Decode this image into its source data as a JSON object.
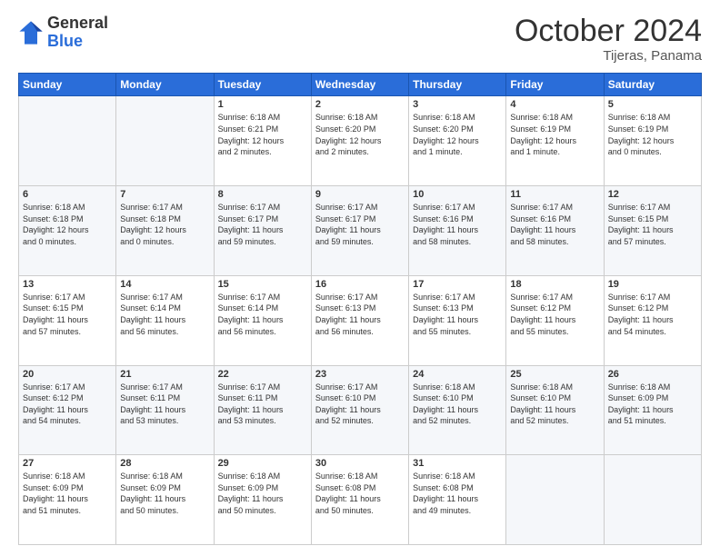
{
  "header": {
    "logo_general": "General",
    "logo_blue": "Blue",
    "month_title": "October 2024",
    "location": "Tijeras, Panama"
  },
  "days_of_week": [
    "Sunday",
    "Monday",
    "Tuesday",
    "Wednesday",
    "Thursday",
    "Friday",
    "Saturday"
  ],
  "weeks": [
    [
      {
        "num": "",
        "info": ""
      },
      {
        "num": "",
        "info": ""
      },
      {
        "num": "1",
        "info": "Sunrise: 6:18 AM\nSunset: 6:21 PM\nDaylight: 12 hours\nand 2 minutes."
      },
      {
        "num": "2",
        "info": "Sunrise: 6:18 AM\nSunset: 6:20 PM\nDaylight: 12 hours\nand 2 minutes."
      },
      {
        "num": "3",
        "info": "Sunrise: 6:18 AM\nSunset: 6:20 PM\nDaylight: 12 hours\nand 1 minute."
      },
      {
        "num": "4",
        "info": "Sunrise: 6:18 AM\nSunset: 6:19 PM\nDaylight: 12 hours\nand 1 minute."
      },
      {
        "num": "5",
        "info": "Sunrise: 6:18 AM\nSunset: 6:19 PM\nDaylight: 12 hours\nand 0 minutes."
      }
    ],
    [
      {
        "num": "6",
        "info": "Sunrise: 6:18 AM\nSunset: 6:18 PM\nDaylight: 12 hours\nand 0 minutes."
      },
      {
        "num": "7",
        "info": "Sunrise: 6:17 AM\nSunset: 6:18 PM\nDaylight: 12 hours\nand 0 minutes."
      },
      {
        "num": "8",
        "info": "Sunrise: 6:17 AM\nSunset: 6:17 PM\nDaylight: 11 hours\nand 59 minutes."
      },
      {
        "num": "9",
        "info": "Sunrise: 6:17 AM\nSunset: 6:17 PM\nDaylight: 11 hours\nand 59 minutes."
      },
      {
        "num": "10",
        "info": "Sunrise: 6:17 AM\nSunset: 6:16 PM\nDaylight: 11 hours\nand 58 minutes."
      },
      {
        "num": "11",
        "info": "Sunrise: 6:17 AM\nSunset: 6:16 PM\nDaylight: 11 hours\nand 58 minutes."
      },
      {
        "num": "12",
        "info": "Sunrise: 6:17 AM\nSunset: 6:15 PM\nDaylight: 11 hours\nand 57 minutes."
      }
    ],
    [
      {
        "num": "13",
        "info": "Sunrise: 6:17 AM\nSunset: 6:15 PM\nDaylight: 11 hours\nand 57 minutes."
      },
      {
        "num": "14",
        "info": "Sunrise: 6:17 AM\nSunset: 6:14 PM\nDaylight: 11 hours\nand 56 minutes."
      },
      {
        "num": "15",
        "info": "Sunrise: 6:17 AM\nSunset: 6:14 PM\nDaylight: 11 hours\nand 56 minutes."
      },
      {
        "num": "16",
        "info": "Sunrise: 6:17 AM\nSunset: 6:13 PM\nDaylight: 11 hours\nand 56 minutes."
      },
      {
        "num": "17",
        "info": "Sunrise: 6:17 AM\nSunset: 6:13 PM\nDaylight: 11 hours\nand 55 minutes."
      },
      {
        "num": "18",
        "info": "Sunrise: 6:17 AM\nSunset: 6:12 PM\nDaylight: 11 hours\nand 55 minutes."
      },
      {
        "num": "19",
        "info": "Sunrise: 6:17 AM\nSunset: 6:12 PM\nDaylight: 11 hours\nand 54 minutes."
      }
    ],
    [
      {
        "num": "20",
        "info": "Sunrise: 6:17 AM\nSunset: 6:12 PM\nDaylight: 11 hours\nand 54 minutes."
      },
      {
        "num": "21",
        "info": "Sunrise: 6:17 AM\nSunset: 6:11 PM\nDaylight: 11 hours\nand 53 minutes."
      },
      {
        "num": "22",
        "info": "Sunrise: 6:17 AM\nSunset: 6:11 PM\nDaylight: 11 hours\nand 53 minutes."
      },
      {
        "num": "23",
        "info": "Sunrise: 6:17 AM\nSunset: 6:10 PM\nDaylight: 11 hours\nand 52 minutes."
      },
      {
        "num": "24",
        "info": "Sunrise: 6:18 AM\nSunset: 6:10 PM\nDaylight: 11 hours\nand 52 minutes."
      },
      {
        "num": "25",
        "info": "Sunrise: 6:18 AM\nSunset: 6:10 PM\nDaylight: 11 hours\nand 52 minutes."
      },
      {
        "num": "26",
        "info": "Sunrise: 6:18 AM\nSunset: 6:09 PM\nDaylight: 11 hours\nand 51 minutes."
      }
    ],
    [
      {
        "num": "27",
        "info": "Sunrise: 6:18 AM\nSunset: 6:09 PM\nDaylight: 11 hours\nand 51 minutes."
      },
      {
        "num": "28",
        "info": "Sunrise: 6:18 AM\nSunset: 6:09 PM\nDaylight: 11 hours\nand 50 minutes."
      },
      {
        "num": "29",
        "info": "Sunrise: 6:18 AM\nSunset: 6:09 PM\nDaylight: 11 hours\nand 50 minutes."
      },
      {
        "num": "30",
        "info": "Sunrise: 6:18 AM\nSunset: 6:08 PM\nDaylight: 11 hours\nand 50 minutes."
      },
      {
        "num": "31",
        "info": "Sunrise: 6:18 AM\nSunset: 6:08 PM\nDaylight: 11 hours\nand 49 minutes."
      },
      {
        "num": "",
        "info": ""
      },
      {
        "num": "",
        "info": ""
      }
    ]
  ]
}
